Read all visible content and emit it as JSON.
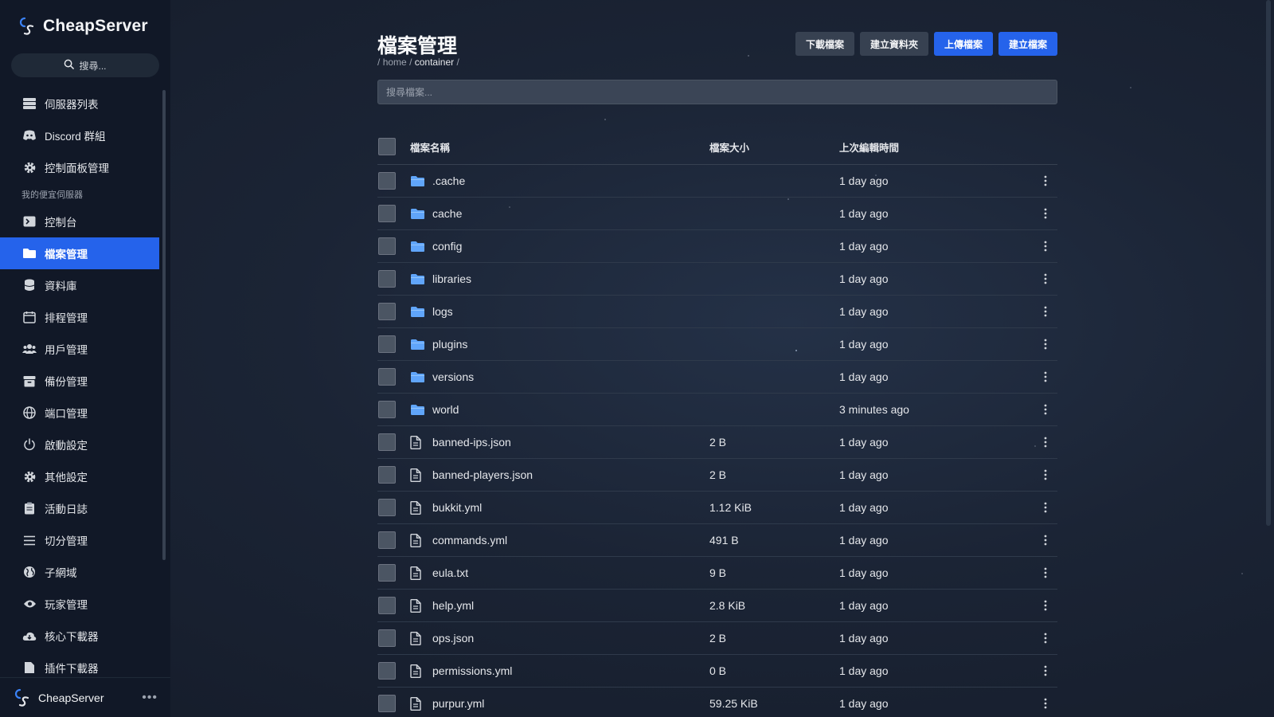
{
  "app": {
    "brand": "CheapServer"
  },
  "sidebar": {
    "search_label": "搜尋...",
    "top_items": [
      {
        "label": "伺服器列表",
        "icon": "server-stack-icon"
      },
      {
        "label": "Discord 群組",
        "icon": "discord-icon"
      },
      {
        "label": "控制面板管理",
        "icon": "gear-icon"
      }
    ],
    "section_label": "我的便宜伺服器",
    "items": [
      {
        "label": "控制台",
        "icon": "terminal-icon"
      },
      {
        "label": "檔案管理",
        "icon": "folder-icon",
        "active": true
      },
      {
        "label": "資料庫",
        "icon": "database-icon"
      },
      {
        "label": "排程管理",
        "icon": "calendar-icon"
      },
      {
        "label": "用戶管理",
        "icon": "users-icon"
      },
      {
        "label": "備份管理",
        "icon": "archive-icon"
      },
      {
        "label": "端口管理",
        "icon": "globe-icon"
      },
      {
        "label": "啟動設定",
        "icon": "power-icon"
      },
      {
        "label": "其他設定",
        "icon": "gear-icon"
      },
      {
        "label": "活動日誌",
        "icon": "clipboard-icon"
      },
      {
        "label": "切分管理",
        "icon": "list-icon"
      },
      {
        "label": "子網域",
        "icon": "earth-icon"
      },
      {
        "label": "玩家管理",
        "icon": "eye-icon"
      },
      {
        "label": "核心下載器",
        "icon": "cloud-download-icon"
      },
      {
        "label": "插件下載器",
        "icon": "file-icon"
      }
    ],
    "user_name": "CheapServer"
  },
  "page": {
    "title": "檔案管理",
    "breadcrumb": {
      "sep": "/",
      "parts": [
        "home",
        "container"
      ]
    },
    "actions": [
      {
        "label": "下載檔案",
        "primary": false
      },
      {
        "label": "建立資料夾",
        "primary": false
      },
      {
        "label": "上傳檔案",
        "primary": true
      },
      {
        "label": "建立檔案",
        "primary": true
      }
    ],
    "search_placeholder": "搜尋檔案..."
  },
  "table": {
    "columns": [
      "檔案名稱",
      "檔案大小",
      "上次編輯時間"
    ],
    "rows": [
      {
        "type": "folder",
        "name": ".cache",
        "size": "",
        "modified": "1 day ago"
      },
      {
        "type": "folder",
        "name": "cache",
        "size": "",
        "modified": "1 day ago"
      },
      {
        "type": "folder",
        "name": "config",
        "size": "",
        "modified": "1 day ago"
      },
      {
        "type": "folder",
        "name": "libraries",
        "size": "",
        "modified": "1 day ago"
      },
      {
        "type": "folder",
        "name": "logs",
        "size": "",
        "modified": "1 day ago"
      },
      {
        "type": "folder",
        "name": "plugins",
        "size": "",
        "modified": "1 day ago"
      },
      {
        "type": "folder",
        "name": "versions",
        "size": "",
        "modified": "1 day ago"
      },
      {
        "type": "folder",
        "name": "world",
        "size": "",
        "modified": "3 minutes ago"
      },
      {
        "type": "file",
        "name": "banned-ips.json",
        "size": "2 B",
        "modified": "1 day ago"
      },
      {
        "type": "file",
        "name": "banned-players.json",
        "size": "2 B",
        "modified": "1 day ago"
      },
      {
        "type": "file",
        "name": "bukkit.yml",
        "size": "1.12 KiB",
        "modified": "1 day ago"
      },
      {
        "type": "file",
        "name": "commands.yml",
        "size": "491 B",
        "modified": "1 day ago"
      },
      {
        "type": "file",
        "name": "eula.txt",
        "size": "9 B",
        "modified": "1 day ago"
      },
      {
        "type": "file",
        "name": "help.yml",
        "size": "2.8 KiB",
        "modified": "1 day ago"
      },
      {
        "type": "file",
        "name": "ops.json",
        "size": "2 B",
        "modified": "1 day ago"
      },
      {
        "type": "file",
        "name": "permissions.yml",
        "size": "0 B",
        "modified": "1 day ago"
      },
      {
        "type": "file",
        "name": "purpur.yml",
        "size": "59.25 KiB",
        "modified": "1 day ago"
      }
    ]
  },
  "colors": {
    "accent": "#2563eb",
    "sidebar_bg": "#111827",
    "folder": "#60a5fa"
  }
}
